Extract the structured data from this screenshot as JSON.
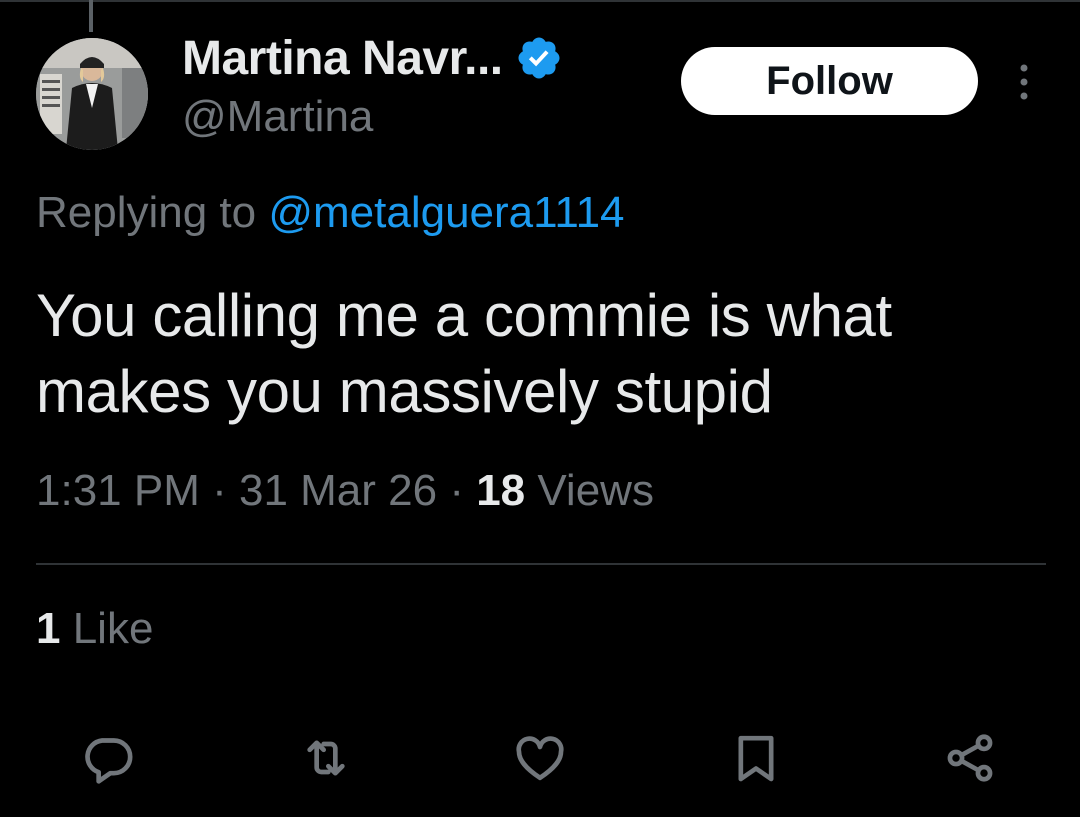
{
  "author": {
    "display_name": "Martina Navr...",
    "handle": "@Martina"
  },
  "header": {
    "follow_label": "Follow"
  },
  "reply": {
    "prefix": "Replying to ",
    "to_handle": "@metalguera1114"
  },
  "tweet": {
    "text": "You calling me a commie is what makes you massively stupid"
  },
  "meta": {
    "time": "1:31 PM",
    "sep1": " · ",
    "date": "31 Mar 26",
    "sep2": " · ",
    "views_count": "18",
    "views_label": " Views"
  },
  "engagement": {
    "like_count": "1",
    "like_label": " Like"
  },
  "icons": {
    "verified": "verified-badge-icon",
    "more": "more-vertical-icon",
    "reply": "reply-bubble-icon",
    "retweet": "retweet-icon",
    "like": "heart-icon",
    "bookmark": "bookmark-icon",
    "share": "share-icon"
  },
  "colors": {
    "background": "#000000",
    "text_primary": "#e7e9ea",
    "text_secondary": "#71767b",
    "link": "#1d9bf0",
    "divider": "#2f3336",
    "verified": "#1d9bf0",
    "follow_bg": "#ffffff"
  }
}
